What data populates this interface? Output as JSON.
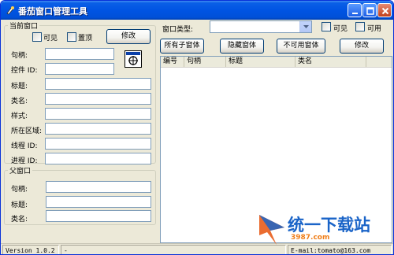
{
  "window": {
    "title": "番茄窗口管理工具"
  },
  "current_window": {
    "group_title": "当前窗口",
    "visible_label": "可见",
    "topmost_label": "置顶",
    "modify_label": "修改",
    "fields": [
      {
        "label": "句柄:",
        "value": ""
      },
      {
        "label": "控件 ID:",
        "value": ""
      },
      {
        "label": "标题:",
        "value": ""
      },
      {
        "label": "类名:",
        "value": ""
      },
      {
        "label": "样式:",
        "value": ""
      },
      {
        "label": "所在区域:",
        "value": ""
      },
      {
        "label": "线程 ID:",
        "value": ""
      },
      {
        "label": "进程 ID:",
        "value": ""
      }
    ]
  },
  "parent_window": {
    "group_title": "父窗口",
    "fields": [
      {
        "label": "句柄:",
        "value": ""
      },
      {
        "label": "标题:",
        "value": ""
      },
      {
        "label": "类名:",
        "value": ""
      }
    ]
  },
  "right_panel": {
    "window_type_label": "窗口类型:",
    "window_type_value": "",
    "visible_label": "可见",
    "enabled_label": "可用",
    "buttons": {
      "all_children": "所有子窗体",
      "hidden": "隐藏窗体",
      "disabled": "不可用窗体",
      "modify": "修改"
    },
    "columns": [
      "编号",
      "句柄",
      "标题",
      "类名"
    ]
  },
  "statusbar": {
    "version": "Version 1.0.2",
    "second": "-",
    "email": "E-mail:tomato@163.com"
  },
  "watermark": {
    "text": "统一下载站",
    "sub": "3987.com"
  },
  "colors": {
    "titlebar": "#0054e3",
    "face": "#ece9d8",
    "field_border": "#7f9db9",
    "watermark_blue": "#1a64c8",
    "watermark_orange": "#f07f1a"
  }
}
